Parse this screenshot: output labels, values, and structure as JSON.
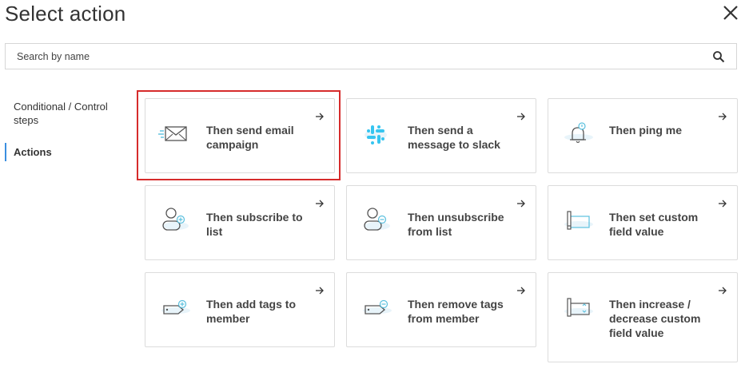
{
  "header": {
    "title": "Select action"
  },
  "search": {
    "placeholder": "Search by name"
  },
  "sidebar": {
    "items": [
      {
        "label": "Conditional / Control steps",
        "active": false
      },
      {
        "label": "Actions",
        "active": true
      }
    ]
  },
  "actions": [
    {
      "label": "Then send email campaign",
      "icon": "envelope-icon"
    },
    {
      "label": "Then send a message to slack",
      "icon": "slack-icon"
    },
    {
      "label": "Then ping me",
      "icon": "bell-icon"
    },
    {
      "label": "Then subscribe to list",
      "icon": "user-add-icon"
    },
    {
      "label": "Then unsubscribe from list",
      "icon": "user-remove-icon"
    },
    {
      "label": "Then set custom field value",
      "icon": "custom-field-icon"
    },
    {
      "label": "Then add tags to member",
      "icon": "tag-add-icon"
    },
    {
      "label": "Then remove tags from member",
      "icon": "tag-remove-icon"
    },
    {
      "label": "Then increase / decrease custom field value",
      "icon": "custom-field-adjust-icon"
    }
  ],
  "colors": {
    "accent": "#3b8fe0",
    "highlight": "#d62b2b",
    "icon_accent": "#5bc0de"
  }
}
